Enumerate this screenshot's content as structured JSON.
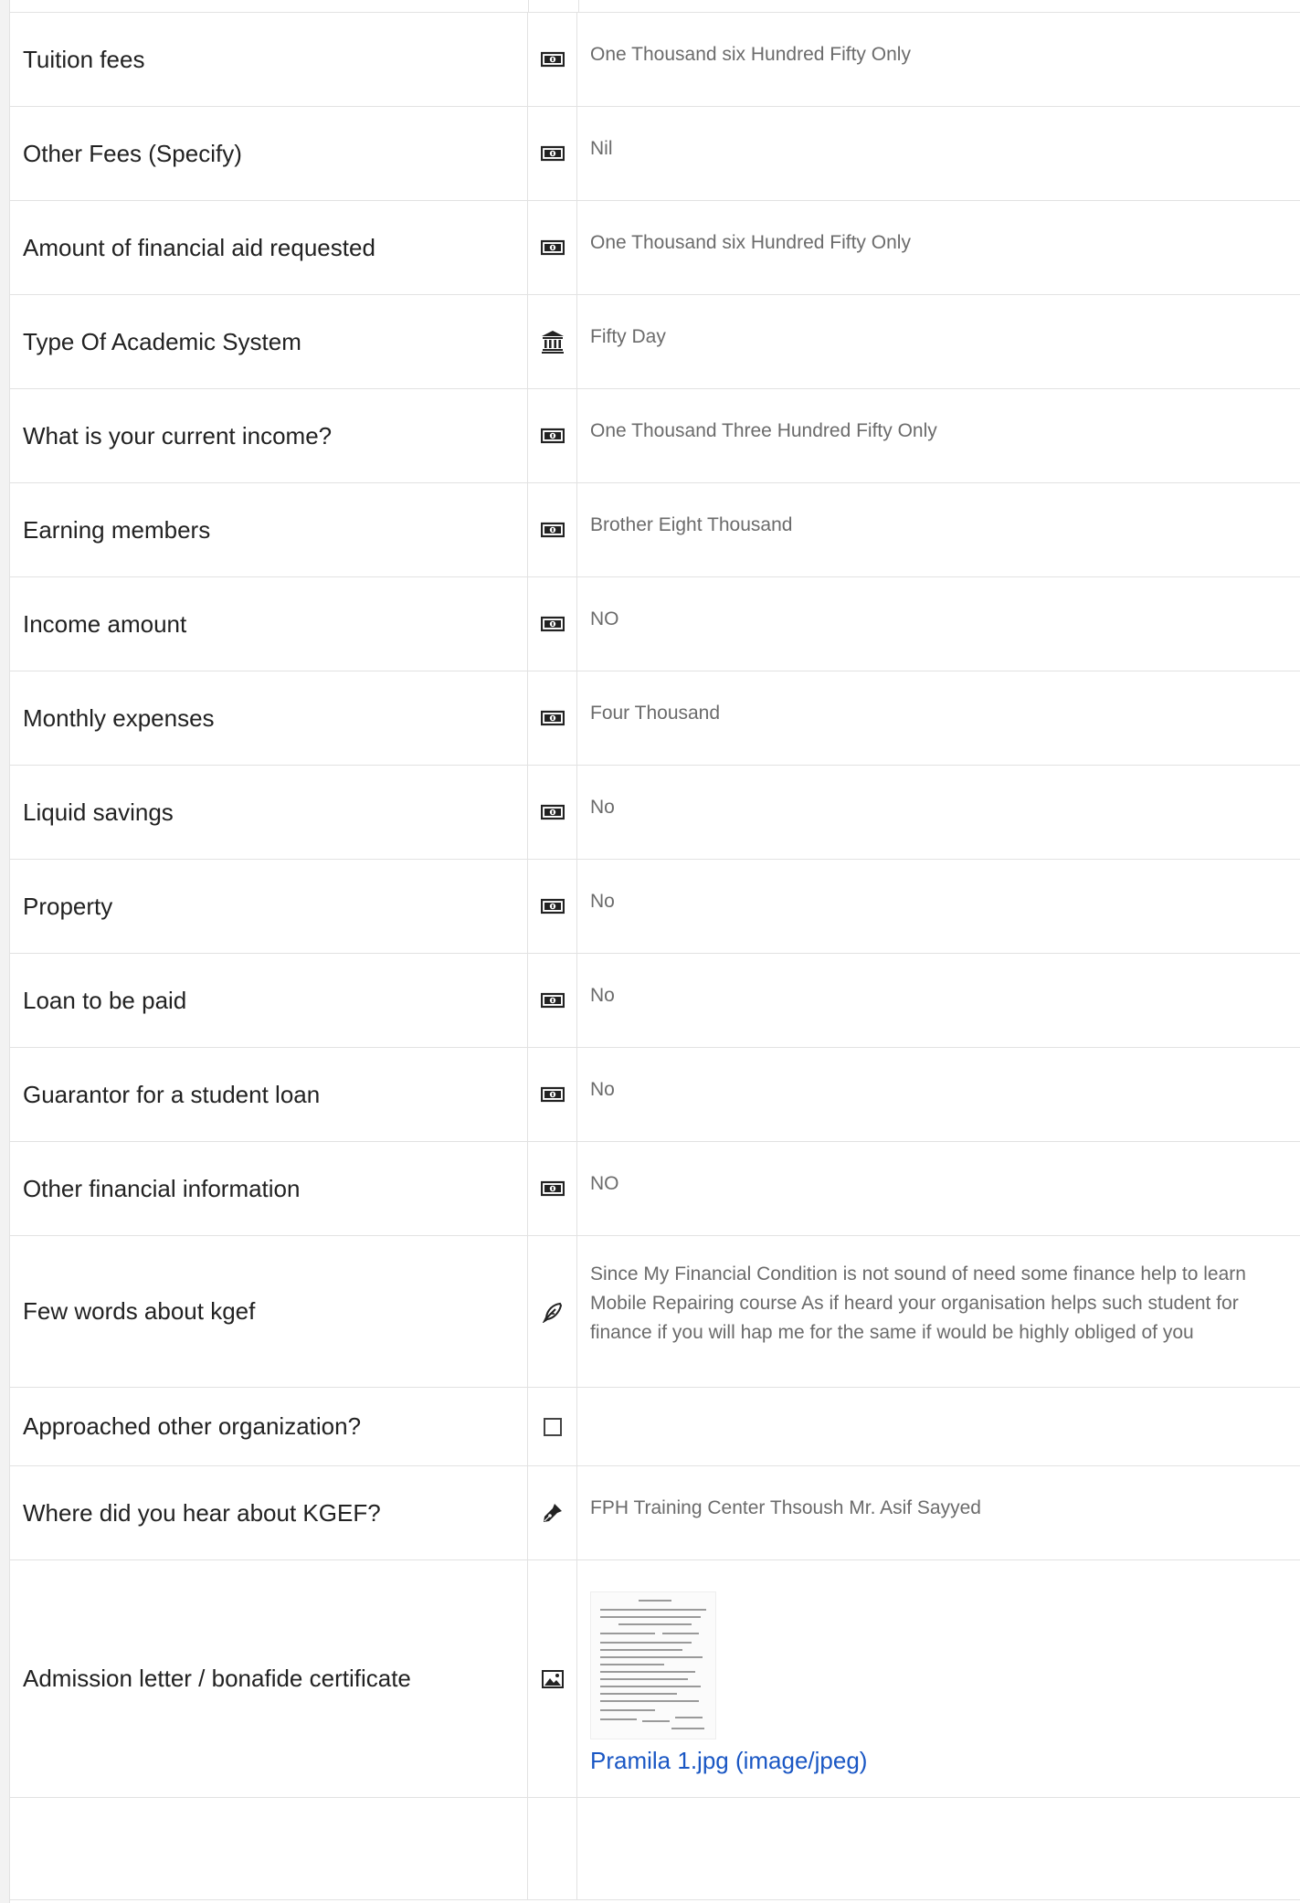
{
  "rows": [
    {
      "label": "Tuition fees",
      "icon": "money-bill-icon",
      "value": "One Thousand six Hundred Fifty Only"
    },
    {
      "label": "Other Fees (Specify)",
      "icon": "money-bill-icon",
      "value": "Nil"
    },
    {
      "label": "Amount of financial aid requested",
      "icon": "money-bill-icon",
      "value": "One Thousand six Hundred Fifty Only"
    },
    {
      "label": "Type Of Academic System",
      "icon": "institution-icon",
      "value": "Fifty Day"
    },
    {
      "label": "What is your current income?",
      "icon": "money-bill-icon",
      "value": "One Thousand Three Hundred Fifty Only"
    },
    {
      "label": "Earning members",
      "icon": "money-bill-icon",
      "value": "Brother Eight Thousand"
    },
    {
      "label": "Income amount",
      "icon": "money-bill-icon",
      "value": "NO"
    },
    {
      "label": "Monthly expenses",
      "icon": "money-bill-icon",
      "value": "Four Thousand"
    },
    {
      "label": "Liquid savings",
      "icon": "money-bill-icon",
      "value": "No"
    },
    {
      "label": "Property",
      "icon": "money-bill-icon",
      "value": "No"
    },
    {
      "label": "Loan to be paid",
      "icon": "money-bill-icon",
      "value": "No"
    },
    {
      "label": "Guarantor for a student loan",
      "icon": "money-bill-icon",
      "value": "No"
    },
    {
      "label": "Other financial information",
      "icon": "money-bill-icon",
      "value": "NO"
    },
    {
      "label": "Few words about kgef",
      "icon": "feather-pen-icon",
      "value": "Since My Financial Condition is not sound of need some finance help to learn Mobile Repairing course As if heard your organisation helps such student for finance if you will hap me for the same if would be highly obliged of you"
    },
    {
      "label": "Approached other organization?",
      "icon": "checkbox-icon",
      "value": ""
    },
    {
      "label": "Where did you hear about KGEF?",
      "icon": "pen-nib-icon",
      "value": "FPH Training Center Thsoush Mr. Asif Sayyed"
    },
    {
      "label": "Admission letter / bonafide certificate",
      "icon": "image-icon",
      "file_name": "Pramila 1.jpg (image/jpeg)"
    }
  ],
  "colors": {
    "link": "#1a57c4",
    "value_text": "#6b6b6b",
    "label_text": "#222222"
  }
}
